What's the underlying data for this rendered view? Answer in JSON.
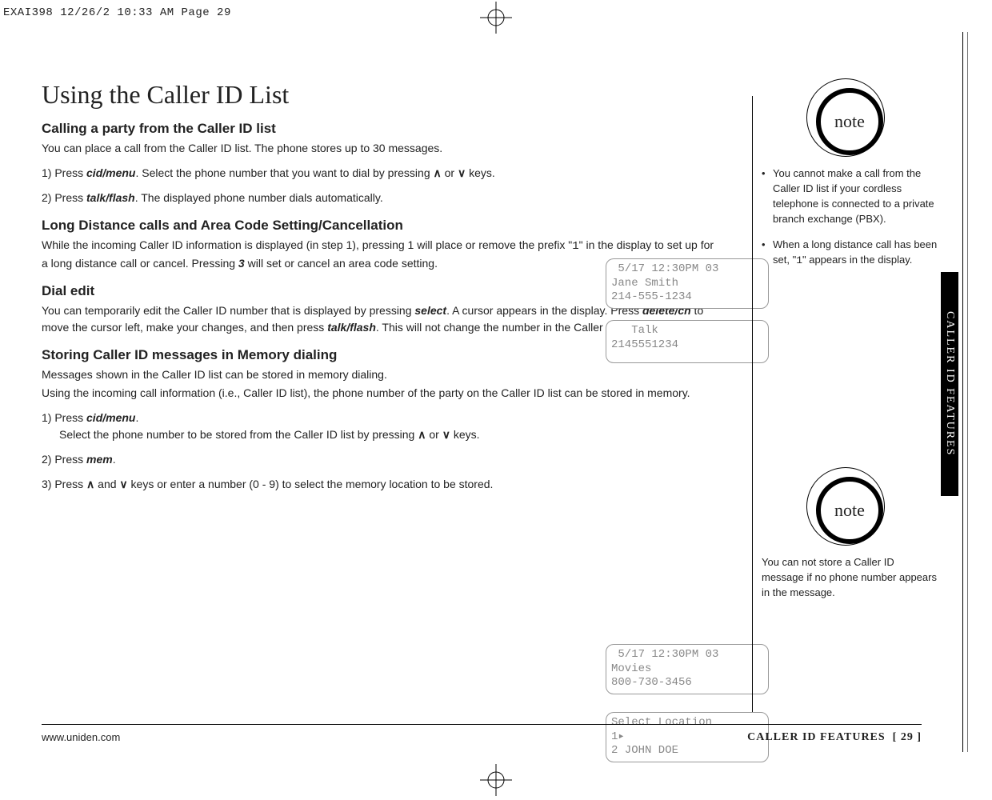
{
  "print_header": "EXAI398  12/26/2  10:33 AM  Page 29",
  "title": "Using the Caller ID List",
  "sec1_h": "Calling a party from the Caller ID list",
  "sec1_p": "You can place a call from the Caller ID list. The phone stores up to 30 messages.",
  "step1_pre": "1) Press ",
  "kw_cidmenu": "cid/menu",
  "step1_mid": ". Select the phone number that you want to dial by pressing ",
  "or_word": " or ",
  "keys_word": " keys.",
  "step2_pre": "2) Press ",
  "kw_talkflash": "talk/flash",
  "step2_post": ". The displayed phone number dials automatically.",
  "sec2_h": "Long Distance calls and Area Code Setting/Cancellation",
  "sec2_p_a": "While the incoming Caller ID information is displayed (in step 1), pressing 1 will place or remove the prefix \"",
  "sec2_glyph": "1",
  "sec2_p_b": "\" in the display to set up for a long distance call or cancel. Pressing ",
  "kw_3": "3",
  "sec2_p_c": " will set or cancel an area code setting.",
  "sec3_h": "Dial edit",
  "sec3_p_a": "You can temporarily edit the Caller ID number that is displayed by pressing ",
  "kw_select": "select",
  "sec3_p_b": ". A cursor appears in the display. Press ",
  "kw_deletech": "delete/ch",
  "sec3_p_c": " to move the cursor left, make your changes, and then press ",
  "sec3_p_d": ". This will not change the number in the Caller ID list memory.",
  "sec4_h": "Storing Caller ID messages in Memory dialing",
  "sec4_p1": "Messages shown in the Caller ID list can be stored in memory dialing.",
  "sec4_p2": "Using the incoming call information (i.e., Caller ID list), the phone number of the party on the Caller ID list can be stored in memory.",
  "s4_step1_a": "1) Press ",
  "s4_step1_b": ".",
  "s4_step1_c": "Select the phone number to be stored from the Caller ID list by pressing ",
  "s4_step2_a": "2) Press ",
  "kw_mem": "mem",
  "s4_step2_b": ".",
  "s4_step3_a": "3) Press ",
  "and_word": " and ",
  "s4_step3_b": " keys or enter a number (0 - 9) to select the memory location to be stored.",
  "lcd1_l1": " 5/17 12:30PM 03",
  "lcd1_l2": "Jane Smith",
  "lcd1_l3": "214-555-1234",
  "lcd2_l1": "   Talk",
  "lcd2_l2": "2145551234",
  "lcd3_l1": " 5/17 12:30PM 03",
  "lcd3_l2": "Movies",
  "lcd3_l3": "800-730-3456",
  "lcd4_l1": "Select Location",
  "lcd4_l2": "1▸",
  "lcd4_l3": "2 JOHN DOE",
  "note_label": "note",
  "side1_b1": "You cannot make a call from the Caller ID list if your cordless telephone is connected to a private branch exchange (PBX).",
  "side1_b2_a": "When a long distance call has been set, \"",
  "side1_b2_glyph": "1",
  "side1_b2_b": "\" appears in the display.",
  "side2_text": "You can not store a Caller ID message if no phone number appears in the message.",
  "side_tab": "CALLER ID FEATURES",
  "footer_left": "www.uniden.com",
  "footer_right_a": "CALLER ID FEATURES",
  "footer_right_b": "[ 29 ]",
  "arrow_up": "∧",
  "arrow_down": "∨"
}
